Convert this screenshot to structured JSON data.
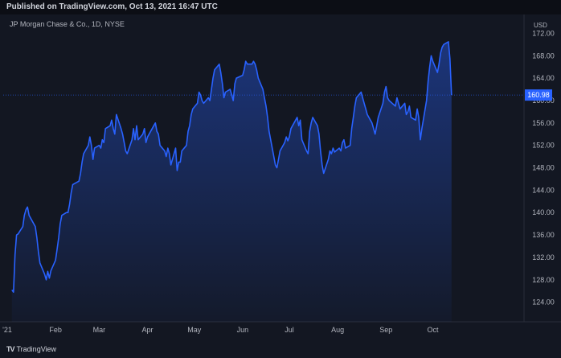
{
  "header": {
    "published": "Published on TradingView.com, Oct 13, 2021 16:47 UTC",
    "symbol": "JP Morgan Chase & Co., 1D, NYSE",
    "currency": "USD"
  },
  "footer": {
    "brand_mark": "TV",
    "brand_name": "TradingView"
  },
  "colors": {
    "background": "#131722",
    "line": "#2962ff",
    "price_tag": "#2962ff",
    "axis_text": "#b2b5be",
    "grid": "#1e222d"
  },
  "chart_data": {
    "type": "area",
    "title": "",
    "xlabel": "",
    "ylabel": "",
    "ylim": [
      120.5,
      174.5
    ],
    "y_ticks": [
      124,
      128,
      132,
      136,
      140,
      144,
      148,
      152,
      156,
      160,
      164,
      168,
      172
    ],
    "y_tick_labels": [
      "124.00",
      "128.00",
      "132.00",
      "136.00",
      "140.00",
      "144.00",
      "148.00",
      "152.00",
      "156.00",
      "160.00",
      "164.00",
      "168.00",
      "172.00"
    ],
    "x_ticks": [
      {
        "label": "'21",
        "date": "2021-01-01"
      },
      {
        "label": "Feb",
        "date": "2021-02-01"
      },
      {
        "label": "Mar",
        "date": "2021-03-01"
      },
      {
        "label": "Apr",
        "date": "2021-04-01"
      },
      {
        "label": "May",
        "date": "2021-05-01"
      },
      {
        "label": "Jun",
        "date": "2021-06-01"
      },
      {
        "label": "Jul",
        "date": "2021-07-01"
      },
      {
        "label": "Aug",
        "date": "2021-08-01"
      },
      {
        "label": "Sep",
        "date": "2021-09-01"
      },
      {
        "label": "Oct",
        "date": "2021-10-01"
      }
    ],
    "last_price": 160.98,
    "last_price_label": "160.98",
    "grid": false,
    "series": [
      {
        "points": [
          [
            "2021-01-04",
            126.2
          ],
          [
            "2021-01-05",
            125.8
          ],
          [
            "2021-01-06",
            132.5
          ],
          [
            "2021-01-07",
            136.0
          ],
          [
            "2021-01-08",
            136.2
          ],
          [
            "2021-01-11",
            137.5
          ],
          [
            "2021-01-12",
            139.5
          ],
          [
            "2021-01-13",
            140.5
          ],
          [
            "2021-01-14",
            141.0
          ],
          [
            "2021-01-15",
            139.5
          ],
          [
            "2021-01-19",
            137.5
          ],
          [
            "2021-01-20",
            135.5
          ],
          [
            "2021-01-21",
            133.0
          ],
          [
            "2021-01-22",
            131.0
          ],
          [
            "2021-01-25",
            129.0
          ],
          [
            "2021-01-26",
            128.0
          ],
          [
            "2021-01-27",
            129.5
          ],
          [
            "2021-01-28",
            128.3
          ],
          [
            "2021-01-29",
            129.6
          ],
          [
            "2021-02-01",
            131.5
          ],
          [
            "2021-02-02",
            133.5
          ],
          [
            "2021-02-03",
            135.5
          ],
          [
            "2021-02-04",
            138.0
          ],
          [
            "2021-02-05",
            139.5
          ],
          [
            "2021-02-08",
            140.0
          ],
          [
            "2021-02-09",
            140.0
          ],
          [
            "2021-02-10",
            141.5
          ],
          [
            "2021-02-11",
            143.5
          ],
          [
            "2021-02-12",
            145.0
          ],
          [
            "2021-02-16",
            145.6
          ],
          [
            "2021-02-17",
            147.0
          ],
          [
            "2021-02-18",
            149.0
          ],
          [
            "2021-02-19",
            150.5
          ],
          [
            "2021-02-22",
            152.0
          ],
          [
            "2021-02-23",
            153.5
          ],
          [
            "2021-02-24",
            152.0
          ],
          [
            "2021-02-25",
            149.5
          ],
          [
            "2021-02-26",
            151.5
          ],
          [
            "2021-03-01",
            152.0
          ],
          [
            "2021-03-02",
            151.5
          ],
          [
            "2021-03-03",
            153.0
          ],
          [
            "2021-03-04",
            152.5
          ],
          [
            "2021-03-05",
            155.0
          ],
          [
            "2021-03-08",
            155.5
          ],
          [
            "2021-03-09",
            156.5
          ],
          [
            "2021-03-10",
            155.0
          ],
          [
            "2021-03-11",
            154.0
          ],
          [
            "2021-03-12",
            157.5
          ],
          [
            "2021-03-15",
            155.0
          ],
          [
            "2021-03-16",
            154.0
          ],
          [
            "2021-03-17",
            152.5
          ],
          [
            "2021-03-18",
            151.0
          ],
          [
            "2021-03-19",
            150.5
          ],
          [
            "2021-03-22",
            153.0
          ],
          [
            "2021-03-23",
            155.0
          ],
          [
            "2021-03-24",
            153.0
          ],
          [
            "2021-03-25",
            155.5
          ],
          [
            "2021-03-26",
            153.0
          ],
          [
            "2021-03-29",
            154.0
          ],
          [
            "2021-03-30",
            155.0
          ],
          [
            "2021-03-31",
            152.5
          ],
          [
            "2021-04-01",
            153.5
          ],
          [
            "2021-04-05",
            155.5
          ],
          [
            "2021-04-06",
            156.0
          ],
          [
            "2021-04-07",
            154.5
          ],
          [
            "2021-04-08",
            154.0
          ],
          [
            "2021-04-09",
            152.0
          ],
          [
            "2021-04-12",
            151.0
          ],
          [
            "2021-04-13",
            150.0
          ],
          [
            "2021-04-14",
            151.5
          ],
          [
            "2021-04-15",
            150.5
          ],
          [
            "2021-04-16",
            148.5
          ],
          [
            "2021-04-19",
            151.5
          ],
          [
            "2021-04-20",
            147.5
          ],
          [
            "2021-04-21",
            149.0
          ],
          [
            "2021-04-22",
            149.0
          ],
          [
            "2021-04-23",
            151.0
          ],
          [
            "2021-04-26",
            152.0
          ],
          [
            "2021-04-27",
            154.5
          ],
          [
            "2021-04-28",
            155.5
          ],
          [
            "2021-04-29",
            157.5
          ],
          [
            "2021-04-30",
            158.5
          ],
          [
            "2021-05-03",
            159.5
          ],
          [
            "2021-05-04",
            161.5
          ],
          [
            "2021-05-05",
            161.0
          ],
          [
            "2021-05-06",
            160.0
          ],
          [
            "2021-05-07",
            159.5
          ],
          [
            "2021-05-10",
            160.5
          ],
          [
            "2021-05-11",
            160.0
          ],
          [
            "2021-05-12",
            162.0
          ],
          [
            "2021-05-13",
            164.0
          ],
          [
            "2021-05-14",
            165.5
          ],
          [
            "2021-05-17",
            166.5
          ],
          [
            "2021-05-18",
            165.0
          ],
          [
            "2021-05-19",
            163.0
          ],
          [
            "2021-05-20",
            160.5
          ],
          [
            "2021-05-21",
            161.5
          ],
          [
            "2021-05-24",
            162.0
          ],
          [
            "2021-05-25",
            161.0
          ],
          [
            "2021-05-26",
            160.0
          ],
          [
            "2021-05-27",
            163.0
          ],
          [
            "2021-05-28",
            164.0
          ],
          [
            "2021-06-01",
            164.5
          ],
          [
            "2021-06-02",
            165.5
          ],
          [
            "2021-06-03",
            167.0
          ],
          [
            "2021-06-04",
            166.5
          ],
          [
            "2021-06-07",
            166.5
          ],
          [
            "2021-06-08",
            167.0
          ],
          [
            "2021-06-09",
            166.5
          ],
          [
            "2021-06-10",
            165.5
          ],
          [
            "2021-06-11",
            164.0
          ],
          [
            "2021-06-14",
            162.0
          ],
          [
            "2021-06-15",
            160.5
          ],
          [
            "2021-06-16",
            159.0
          ],
          [
            "2021-06-17",
            157.0
          ],
          [
            "2021-06-18",
            154.5
          ],
          [
            "2021-06-21",
            150.0
          ],
          [
            "2021-06-22",
            148.5
          ],
          [
            "2021-06-23",
            148.0
          ],
          [
            "2021-06-24",
            149.5
          ],
          [
            "2021-06-25",
            151.0
          ],
          [
            "2021-06-28",
            152.5
          ],
          [
            "2021-06-29",
            153.5
          ],
          [
            "2021-06-30",
            152.8
          ],
          [
            "2021-07-01",
            153.5
          ],
          [
            "2021-07-02",
            155.0
          ],
          [
            "2021-07-06",
            157.0
          ],
          [
            "2021-07-07",
            155.5
          ],
          [
            "2021-07-08",
            156.5
          ],
          [
            "2021-07-09",
            153.0
          ],
          [
            "2021-07-12",
            151.0
          ],
          [
            "2021-07-13",
            150.5
          ],
          [
            "2021-07-14",
            154.5
          ],
          [
            "2021-07-15",
            156.0
          ],
          [
            "2021-07-16",
            157.0
          ],
          [
            "2021-07-19",
            155.5
          ],
          [
            "2021-07-20",
            154.0
          ],
          [
            "2021-07-21",
            151.0
          ],
          [
            "2021-07-22",
            148.5
          ],
          [
            "2021-07-23",
            147.0
          ],
          [
            "2021-07-26",
            149.5
          ],
          [
            "2021-07-27",
            151.0
          ],
          [
            "2021-07-28",
            150.5
          ],
          [
            "2021-07-29",
            151.5
          ],
          [
            "2021-07-30",
            150.8
          ],
          [
            "2021-08-02",
            151.5
          ],
          [
            "2021-08-03",
            151.0
          ],
          [
            "2021-08-04",
            152.5
          ],
          [
            "2021-08-05",
            153.0
          ],
          [
            "2021-08-06",
            151.5
          ],
          [
            "2021-08-09",
            152.0
          ],
          [
            "2021-08-10",
            155.0
          ],
          [
            "2021-08-11",
            157.0
          ],
          [
            "2021-08-12",
            159.0
          ],
          [
            "2021-08-13",
            160.5
          ],
          [
            "2021-08-16",
            161.5
          ],
          [
            "2021-08-17",
            160.5
          ],
          [
            "2021-08-18",
            159.5
          ],
          [
            "2021-08-19",
            158.5
          ],
          [
            "2021-08-20",
            157.5
          ],
          [
            "2021-08-23",
            156.0
          ],
          [
            "2021-08-24",
            155.0
          ],
          [
            "2021-08-25",
            154.0
          ],
          [
            "2021-08-26",
            155.5
          ],
          [
            "2021-08-27",
            157.0
          ],
          [
            "2021-08-30",
            159.5
          ],
          [
            "2021-08-31",
            161.5
          ],
          [
            "2021-09-01",
            162.5
          ],
          [
            "2021-09-02",
            160.5
          ],
          [
            "2021-09-03",
            160.0
          ],
          [
            "2021-09-07",
            159.0
          ],
          [
            "2021-09-08",
            160.5
          ],
          [
            "2021-09-09",
            159.5
          ],
          [
            "2021-09-10",
            158.5
          ],
          [
            "2021-09-13",
            159.5
          ],
          [
            "2021-09-14",
            157.5
          ],
          [
            "2021-09-15",
            158.0
          ],
          [
            "2021-09-16",
            159.0
          ],
          [
            "2021-09-17",
            157.0
          ],
          [
            "2021-09-20",
            156.5
          ],
          [
            "2021-09-21",
            158.5
          ],
          [
            "2021-09-22",
            157.0
          ],
          [
            "2021-09-23",
            153.0
          ],
          [
            "2021-09-24",
            155.0
          ],
          [
            "2021-09-27",
            160.0
          ],
          [
            "2021-09-28",
            163.5
          ],
          [
            "2021-09-29",
            166.0
          ],
          [
            "2021-09-30",
            168.0
          ],
          [
            "2021-10-01",
            167.0
          ],
          [
            "2021-10-04",
            165.0
          ],
          [
            "2021-10-05",
            166.5
          ],
          [
            "2021-10-06",
            168.5
          ],
          [
            "2021-10-07",
            169.5
          ],
          [
            "2021-10-08",
            170.0
          ],
          [
            "2021-10-11",
            170.5
          ],
          [
            "2021-10-12",
            167.5
          ],
          [
            "2021-10-13",
            160.98
          ]
        ]
      }
    ]
  }
}
